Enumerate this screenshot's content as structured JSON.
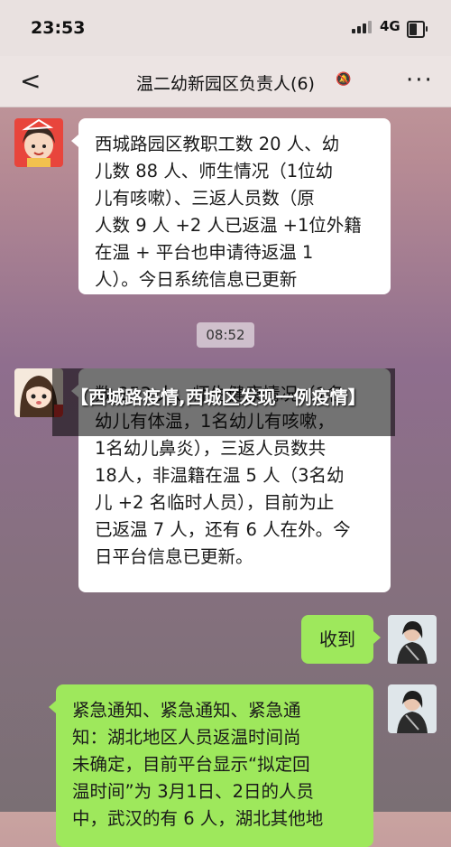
{
  "status": {
    "time": "23:53",
    "network": "4G"
  },
  "header": {
    "back": "<",
    "title": "温二幼新园区负责人(6)",
    "mute": "🔕",
    "more": "···"
  },
  "messages": [
    {
      "side": "left",
      "text": "西城路园区教职工数 20 人、幼\n儿数 88 人、师生情况（1位幼\n儿有咳嗽）、三返人员数（原\n人数 9 人 +2 人已返温 +1位外籍\n在温 + 平台也申请待返温 1\n人）。今日系统信息已更新"
    },
    {
      "side": "left",
      "text": "数 253 人、师生健康情况（1名\n幼儿有体温，1名幼儿有咳嗽，\n1名幼儿鼻炎），三返人员数共\n18人，非温籍在温 5 人（3名幼\n儿 +2 名临时人员），目前为止\n已返温 7 人，还有 6 人在外。今\n日平台信息已更新。"
    },
    {
      "side": "right",
      "text": "收到"
    },
    {
      "side": "left",
      "text": "紧急通知、紧急通知、紧急通\n知：湖北地区人员返温时间尚\n未确定，目前平台显示“拟定回\n温时间”为 3月1日、2日的人员\n中，武汉的有 6 人，湖北其他地"
    }
  ],
  "timestamp": "08:52",
  "overlay": {
    "text": "【西城路疫情,西城区发现一例疫情】"
  }
}
